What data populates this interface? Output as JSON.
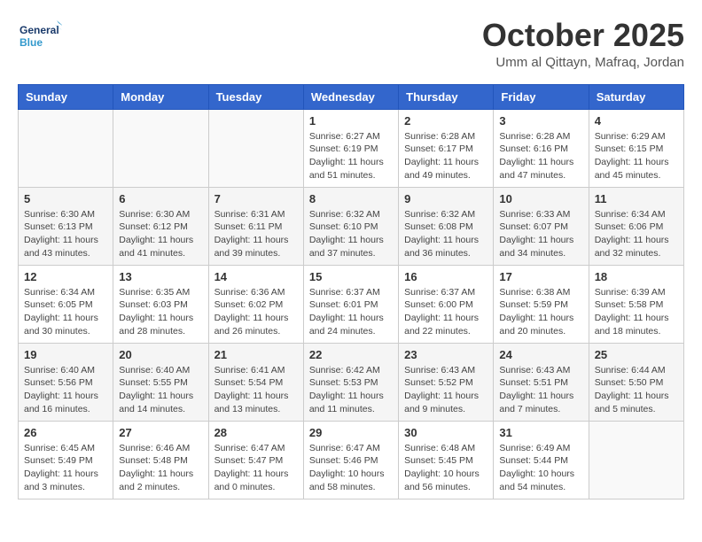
{
  "header": {
    "logo_line1": "General",
    "logo_line2": "Blue",
    "month_title": "October 2025",
    "location": "Umm al Qittayn, Mafraq, Jordan"
  },
  "weekdays": [
    "Sunday",
    "Monday",
    "Tuesday",
    "Wednesday",
    "Thursday",
    "Friday",
    "Saturday"
  ],
  "weeks": [
    [
      {
        "day": "",
        "info": ""
      },
      {
        "day": "",
        "info": ""
      },
      {
        "day": "",
        "info": ""
      },
      {
        "day": "1",
        "info": "Sunrise: 6:27 AM\nSunset: 6:19 PM\nDaylight: 11 hours\nand 51 minutes."
      },
      {
        "day": "2",
        "info": "Sunrise: 6:28 AM\nSunset: 6:17 PM\nDaylight: 11 hours\nand 49 minutes."
      },
      {
        "day": "3",
        "info": "Sunrise: 6:28 AM\nSunset: 6:16 PM\nDaylight: 11 hours\nand 47 minutes."
      },
      {
        "day": "4",
        "info": "Sunrise: 6:29 AM\nSunset: 6:15 PM\nDaylight: 11 hours\nand 45 minutes."
      }
    ],
    [
      {
        "day": "5",
        "info": "Sunrise: 6:30 AM\nSunset: 6:13 PM\nDaylight: 11 hours\nand 43 minutes."
      },
      {
        "day": "6",
        "info": "Sunrise: 6:30 AM\nSunset: 6:12 PM\nDaylight: 11 hours\nand 41 minutes."
      },
      {
        "day": "7",
        "info": "Sunrise: 6:31 AM\nSunset: 6:11 PM\nDaylight: 11 hours\nand 39 minutes."
      },
      {
        "day": "8",
        "info": "Sunrise: 6:32 AM\nSunset: 6:10 PM\nDaylight: 11 hours\nand 37 minutes."
      },
      {
        "day": "9",
        "info": "Sunrise: 6:32 AM\nSunset: 6:08 PM\nDaylight: 11 hours\nand 36 minutes."
      },
      {
        "day": "10",
        "info": "Sunrise: 6:33 AM\nSunset: 6:07 PM\nDaylight: 11 hours\nand 34 minutes."
      },
      {
        "day": "11",
        "info": "Sunrise: 6:34 AM\nSunset: 6:06 PM\nDaylight: 11 hours\nand 32 minutes."
      }
    ],
    [
      {
        "day": "12",
        "info": "Sunrise: 6:34 AM\nSunset: 6:05 PM\nDaylight: 11 hours\nand 30 minutes."
      },
      {
        "day": "13",
        "info": "Sunrise: 6:35 AM\nSunset: 6:03 PM\nDaylight: 11 hours\nand 28 minutes."
      },
      {
        "day": "14",
        "info": "Sunrise: 6:36 AM\nSunset: 6:02 PM\nDaylight: 11 hours\nand 26 minutes."
      },
      {
        "day": "15",
        "info": "Sunrise: 6:37 AM\nSunset: 6:01 PM\nDaylight: 11 hours\nand 24 minutes."
      },
      {
        "day": "16",
        "info": "Sunrise: 6:37 AM\nSunset: 6:00 PM\nDaylight: 11 hours\nand 22 minutes."
      },
      {
        "day": "17",
        "info": "Sunrise: 6:38 AM\nSunset: 5:59 PM\nDaylight: 11 hours\nand 20 minutes."
      },
      {
        "day": "18",
        "info": "Sunrise: 6:39 AM\nSunset: 5:58 PM\nDaylight: 11 hours\nand 18 minutes."
      }
    ],
    [
      {
        "day": "19",
        "info": "Sunrise: 6:40 AM\nSunset: 5:56 PM\nDaylight: 11 hours\nand 16 minutes."
      },
      {
        "day": "20",
        "info": "Sunrise: 6:40 AM\nSunset: 5:55 PM\nDaylight: 11 hours\nand 14 minutes."
      },
      {
        "day": "21",
        "info": "Sunrise: 6:41 AM\nSunset: 5:54 PM\nDaylight: 11 hours\nand 13 minutes."
      },
      {
        "day": "22",
        "info": "Sunrise: 6:42 AM\nSunset: 5:53 PM\nDaylight: 11 hours\nand 11 minutes."
      },
      {
        "day": "23",
        "info": "Sunrise: 6:43 AM\nSunset: 5:52 PM\nDaylight: 11 hours\nand 9 minutes."
      },
      {
        "day": "24",
        "info": "Sunrise: 6:43 AM\nSunset: 5:51 PM\nDaylight: 11 hours\nand 7 minutes."
      },
      {
        "day": "25",
        "info": "Sunrise: 6:44 AM\nSunset: 5:50 PM\nDaylight: 11 hours\nand 5 minutes."
      }
    ],
    [
      {
        "day": "26",
        "info": "Sunrise: 6:45 AM\nSunset: 5:49 PM\nDaylight: 11 hours\nand 3 minutes."
      },
      {
        "day": "27",
        "info": "Sunrise: 6:46 AM\nSunset: 5:48 PM\nDaylight: 11 hours\nand 2 minutes."
      },
      {
        "day": "28",
        "info": "Sunrise: 6:47 AM\nSunset: 5:47 PM\nDaylight: 11 hours\nand 0 minutes."
      },
      {
        "day": "29",
        "info": "Sunrise: 6:47 AM\nSunset: 5:46 PM\nDaylight: 10 hours\nand 58 minutes."
      },
      {
        "day": "30",
        "info": "Sunrise: 6:48 AM\nSunset: 5:45 PM\nDaylight: 10 hours\nand 56 minutes."
      },
      {
        "day": "31",
        "info": "Sunrise: 6:49 AM\nSunset: 5:44 PM\nDaylight: 10 hours\nand 54 minutes."
      },
      {
        "day": "",
        "info": ""
      }
    ]
  ]
}
